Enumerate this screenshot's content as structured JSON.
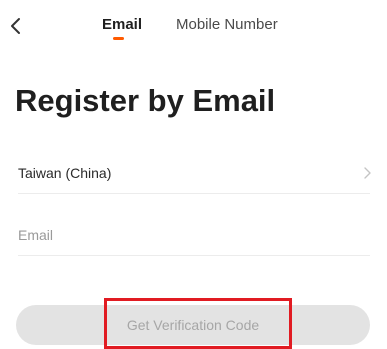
{
  "header": {
    "back_icon": "chevron-left-icon",
    "tabs": [
      {
        "label": "Email",
        "active": true
      },
      {
        "label": "Mobile Number",
        "active": false
      }
    ],
    "active_color": "#ff5a00"
  },
  "main": {
    "title": "Register by Email",
    "region": {
      "value": "Taiwan (China)",
      "icon": "chevron-right-icon"
    },
    "email": {
      "value": "",
      "placeholder": "Email"
    },
    "verify_button": {
      "label": "Get Verification Code",
      "enabled": false
    }
  },
  "annotation": {
    "highlight_color": "#e11b22"
  }
}
